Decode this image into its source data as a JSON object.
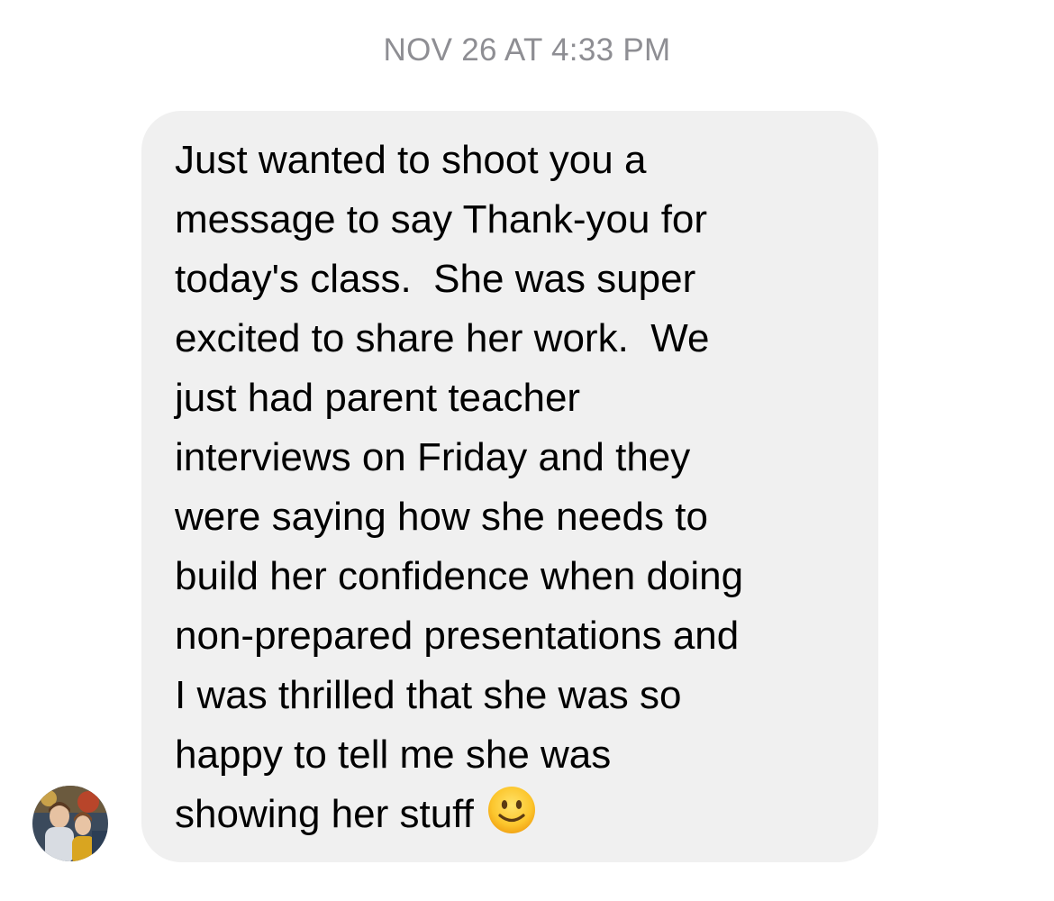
{
  "conversation": {
    "timestamp": "NOV 26 AT 4:33 PM",
    "sender_avatar_icon": "profile-photo-avatar",
    "message": {
      "lines": [
        "Just wanted to shoot you a",
        "message to say Thank-you for",
        "today's class.  She was super",
        "excited to share her work.  We",
        "just had parent teacher",
        "interviews on Friday and they",
        "were saying how she needs to",
        "build her confidence when doing",
        "non-prepared presentations and",
        "I was thrilled that she was so",
        "happy to tell me she was",
        "showing her stuff"
      ],
      "trailing_emoji": "slightly-smiling-face-emoji"
    }
  },
  "colors": {
    "bubble_background": "#f0f0f0",
    "timestamp_text": "#8e8e93",
    "message_text": "#000000"
  }
}
